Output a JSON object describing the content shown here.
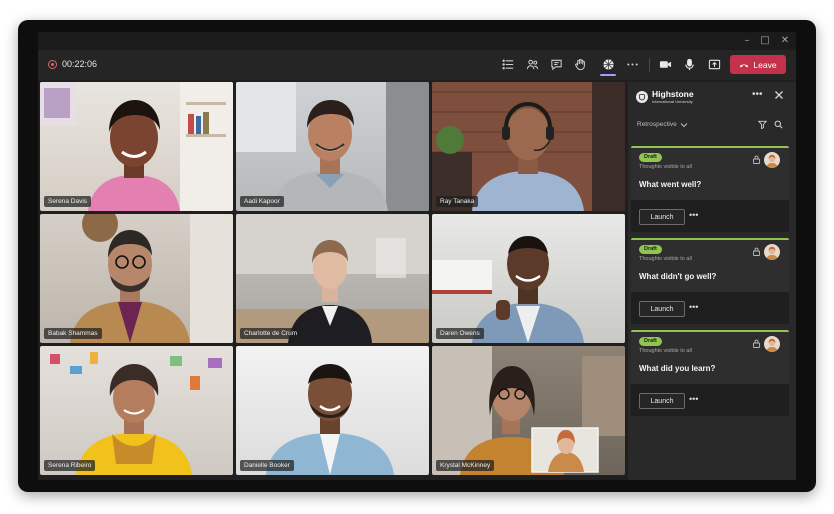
{
  "meeting": {
    "elapsed": "00:22:06",
    "leave_label": "Leave",
    "colors": {
      "leave": "#c4314b",
      "accent": "#9ea2ff",
      "draft": "#92c353"
    }
  },
  "toolbar_icons": [
    "list-icon",
    "people-icon",
    "chat-icon",
    "raise-hand-icon",
    "apps-icon",
    "more-icon",
    "camera-icon",
    "microphone-icon",
    "share-icon",
    "phone-icon"
  ],
  "participants": [
    {
      "name": "Serena Davis"
    },
    {
      "name": "Aadi Kapoor"
    },
    {
      "name": "Ray Tanaka"
    },
    {
      "name": "Babak Shammas"
    },
    {
      "name": "Charlotte de Crum"
    },
    {
      "name": "Daren Owens"
    },
    {
      "name": "Serena Ribeiro"
    },
    {
      "name": "Danielle Booker"
    },
    {
      "name": "Krystal McKinney"
    }
  ],
  "panel": {
    "brand_title": "Highstone",
    "brand_subtitle": "International University",
    "filter_label": "Retrospective",
    "cards": [
      {
        "badge": "Draft",
        "visibility": "Thoughts visible to all",
        "question": "What went well?",
        "launch": "Launch"
      },
      {
        "badge": "Draft",
        "visibility": "Thoughts visible to all",
        "question": "What didn't go well?",
        "launch": "Launch"
      },
      {
        "badge": "Draft",
        "visibility": "Thoughts visible to all",
        "question": "What did you learn?",
        "launch": "Launch"
      }
    ]
  }
}
